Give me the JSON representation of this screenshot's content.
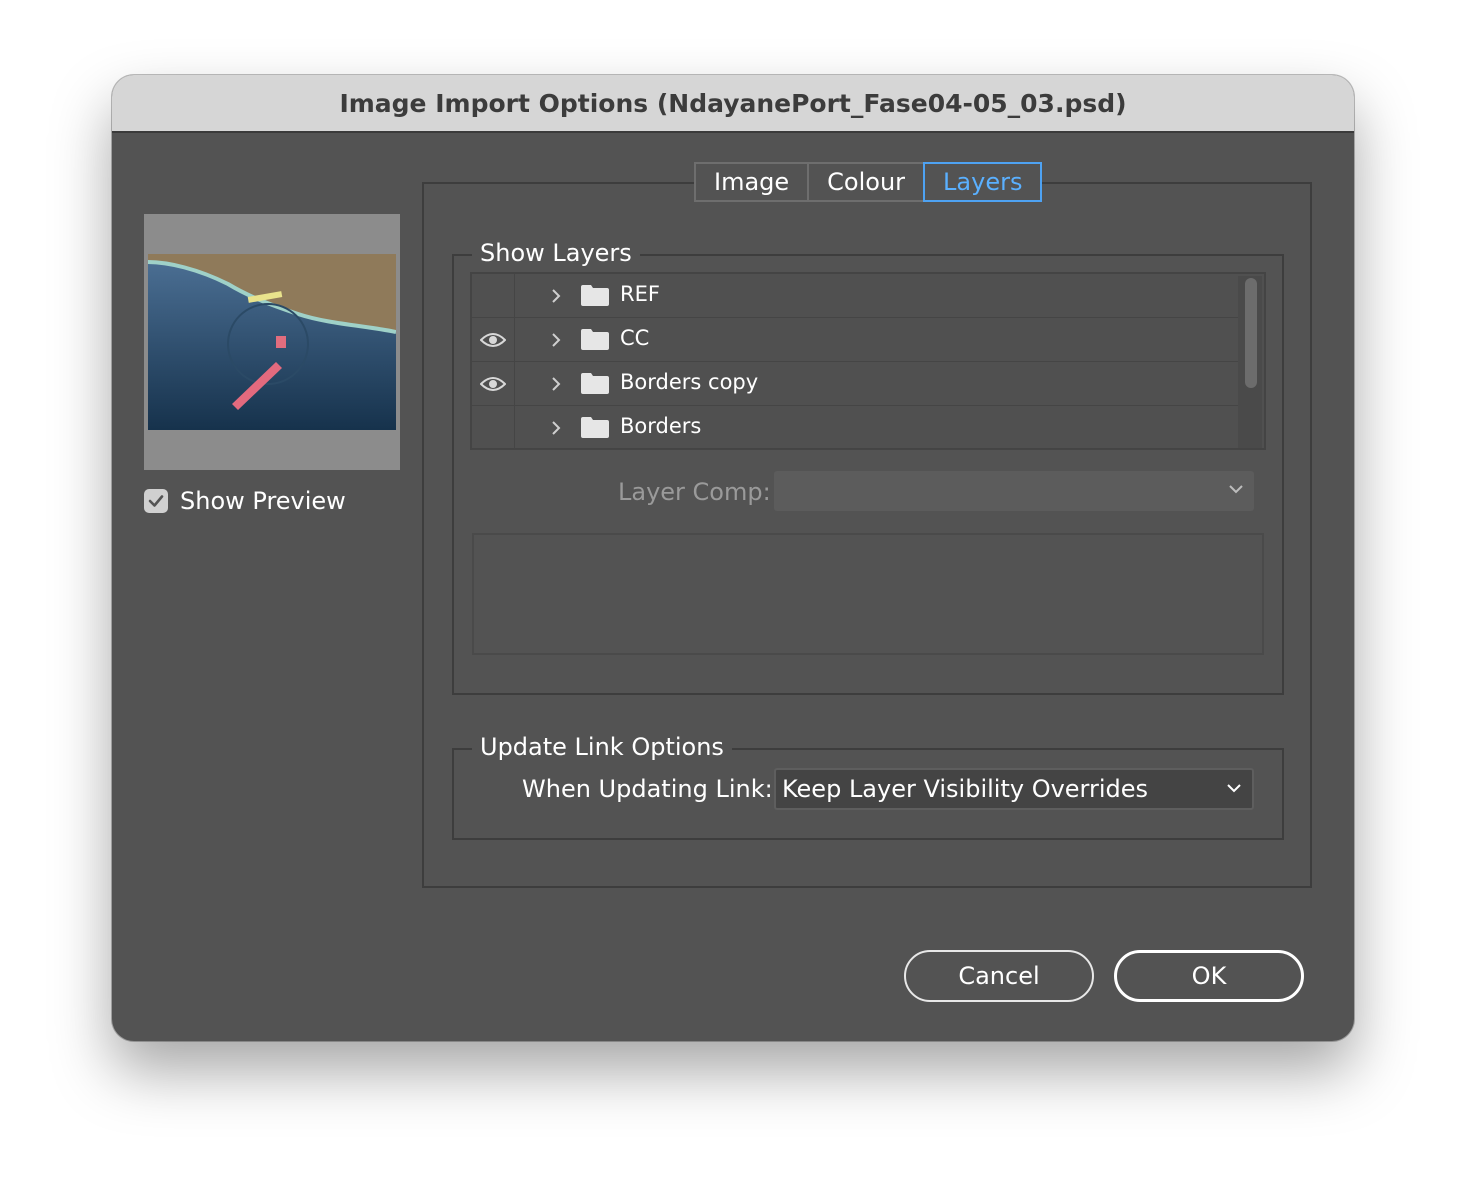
{
  "window": {
    "title": "Image Import Options (NdayanePort_Fase04-05_03.psd)"
  },
  "preview": {
    "show_preview_label": "Show Preview",
    "show_preview_checked": true
  },
  "tabs": [
    {
      "label": "Image",
      "active": false
    },
    {
      "label": "Colour",
      "active": false
    },
    {
      "label": "Layers",
      "active": true
    }
  ],
  "show_layers": {
    "title": "Show Layers",
    "layers": [
      {
        "name": "REF",
        "visible": false
      },
      {
        "name": "CC",
        "visible": true
      },
      {
        "name": "Borders copy",
        "visible": true
      },
      {
        "name": "Borders",
        "visible": false
      }
    ],
    "layer_comp_label": "Layer Comp:",
    "layer_comp_value": ""
  },
  "update_link": {
    "title": "Update Link Options",
    "when_label": "When Updating Link:",
    "when_value": "Keep Layer Visibility Overrides"
  },
  "buttons": {
    "cancel": "Cancel",
    "ok": "OK"
  },
  "colors": {
    "accent": "#4ea2f2",
    "dialog_bg": "#535353",
    "titlebar_bg": "#d6d6d6"
  }
}
